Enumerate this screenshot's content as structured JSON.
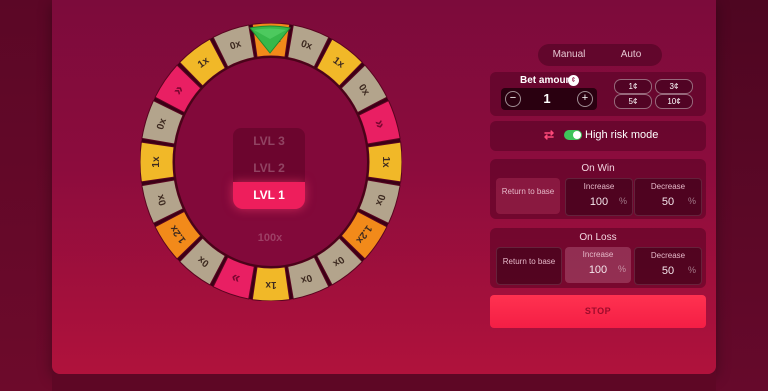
{
  "wheel": {
    "segments": [
      {
        "label": "1.2x",
        "color": "#f28a1a",
        "icon": ""
      },
      {
        "label": "0x",
        "color": "#b3a48c",
        "icon": ""
      },
      {
        "label": "1x",
        "color": "#f1b828",
        "icon": ""
      },
      {
        "label": "0x",
        "color": "#b3a48c",
        "icon": ""
      },
      {
        "label": "",
        "color": "#e91f63",
        "icon": "chevrons-right-icon"
      },
      {
        "label": "1x",
        "color": "#f1b828",
        "icon": ""
      },
      {
        "label": "0x",
        "color": "#b3a48c",
        "icon": ""
      },
      {
        "label": "1.2x",
        "color": "#f28a1a",
        "icon": ""
      },
      {
        "label": "0x",
        "color": "#b3a48c",
        "icon": ""
      },
      {
        "label": "0x",
        "color": "#b3a48c",
        "icon": ""
      },
      {
        "label": "1x",
        "color": "#f1b828",
        "icon": ""
      },
      {
        "label": "",
        "color": "#e91f63",
        "icon": "chevrons-down-icon"
      },
      {
        "label": "0x",
        "color": "#b3a48c",
        "icon": ""
      },
      {
        "label": "1.2x",
        "color": "#f28a1a",
        "icon": ""
      },
      {
        "label": "0x",
        "color": "#b3a48c",
        "icon": ""
      },
      {
        "label": "1x",
        "color": "#f1b828",
        "icon": ""
      },
      {
        "label": "0x",
        "color": "#b3a48c",
        "icon": ""
      },
      {
        "label": "",
        "color": "#e91f63",
        "icon": "chevrons-left-icon"
      },
      {
        "label": "1x",
        "color": "#f1b828",
        "icon": ""
      },
      {
        "label": "0x",
        "color": "#b3a48c",
        "icon": ""
      }
    ],
    "pointer_color": "#37b84a"
  },
  "levels": [
    "LVL 3",
    "LVL 2",
    "LVL 1"
  ],
  "active_level": "LVL 1",
  "center_multiplier": "100x",
  "modes": {
    "manual": "Manual",
    "auto": "Auto"
  },
  "bet": {
    "label": "Bet amount",
    "coin_icon": "coin-icon",
    "value": "1",
    "minus": "−",
    "plus": "+",
    "chips": [
      "1¢",
      "3¢",
      "5¢",
      "10¢"
    ]
  },
  "risk": {
    "label": "High risk mode",
    "enabled": true
  },
  "on_win": {
    "title": "On Win",
    "return_label": "Return to base",
    "increase_label": "Increase",
    "increase_value": "100",
    "decrease_label": "Decrease",
    "decrease_value": "50",
    "pct": "%"
  },
  "on_loss": {
    "title": "On Loss",
    "return_label": "Return to base",
    "increase_label": "Increase",
    "increase_value": "100",
    "decrease_label": "Decrease",
    "decrease_value": "50",
    "pct": "%"
  },
  "stop_label": "STOP"
}
